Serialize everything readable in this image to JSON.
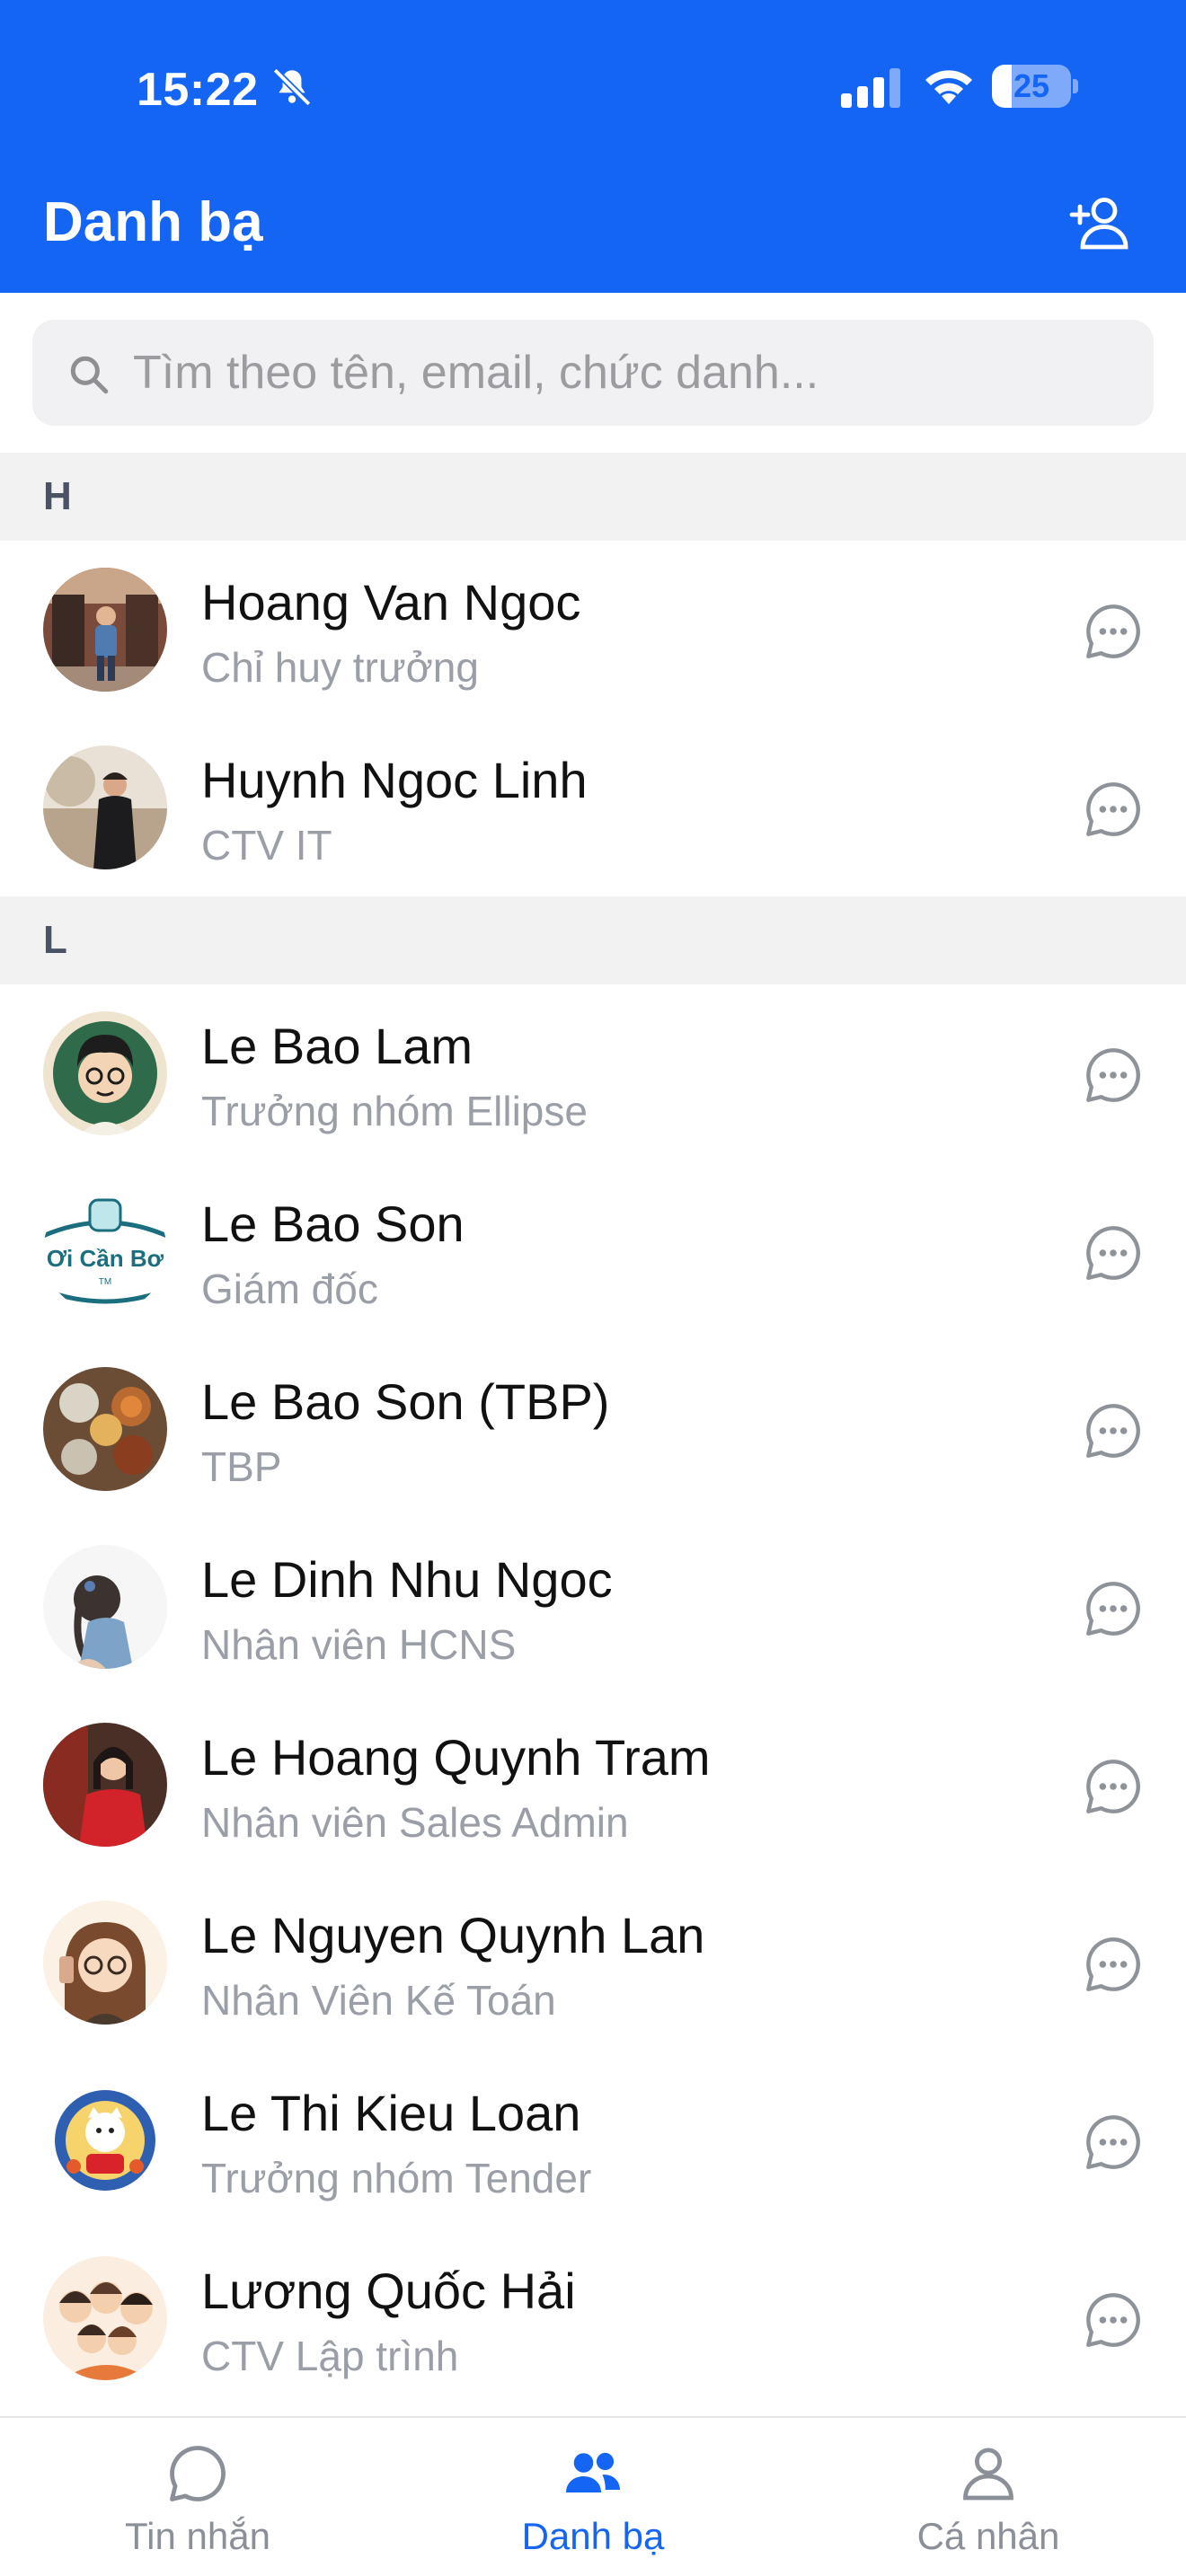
{
  "status_bar": {
    "time": "15:22",
    "battery_level": "25",
    "battery_fraction": 0.25,
    "icons": [
      "bell-off-icon",
      "cellular-signal-icon",
      "wifi-icon",
      "battery-icon"
    ]
  },
  "header": {
    "title": "Danh bạ",
    "add_contact_icon": "add-person-icon"
  },
  "search": {
    "placeholder": "Tìm theo tên, email, chức danh...",
    "value": ""
  },
  "sections": [
    {
      "letter": "H",
      "contacts": [
        {
          "name": "Hoang Van Ngoc",
          "title": "Chỉ huy trưởng"
        },
        {
          "name": "Huynh Ngoc Linh",
          "title": "CTV IT"
        }
      ]
    },
    {
      "letter": "L",
      "contacts": [
        {
          "name": "Le Bao Lam",
          "title": "Trưởng nhóm Ellipse"
        },
        {
          "name": "Le Bao Son",
          "title": "Giám đốc",
          "avatar_text": "Ơi Cần Bơ",
          "avatar_tm": "TM"
        },
        {
          "name": "Le Bao Son (TBP)",
          "title": "TBP"
        },
        {
          "name": "Le Dinh Nhu Ngoc",
          "title": "Nhân viên HCNS"
        },
        {
          "name": "Le Hoang Quynh Tram",
          "title": "Nhân viên Sales Admin"
        },
        {
          "name": "Le Nguyen Quynh Lan",
          "title": "Nhân Viên Kế Toán"
        },
        {
          "name": "Le Thi Kieu Loan",
          "title": "Trưởng nhóm Tender"
        },
        {
          "name": "Lương Quốc Hải",
          "title": "CTV Lập trình"
        }
      ]
    }
  ],
  "tab_bar": {
    "tabs": [
      {
        "label": "Tin nhắn",
        "icon": "chat-bubble-icon",
        "active": false
      },
      {
        "label": "Danh bạ",
        "icon": "contacts-icon",
        "active": true
      },
      {
        "label": "Cá nhân",
        "icon": "person-icon",
        "active": false
      }
    ]
  },
  "colors": {
    "primary": "#1565f5",
    "section_bg": "#f2f2f3",
    "secondary_text": "#9a9ea6",
    "inactive_tab": "#8a8f98"
  }
}
